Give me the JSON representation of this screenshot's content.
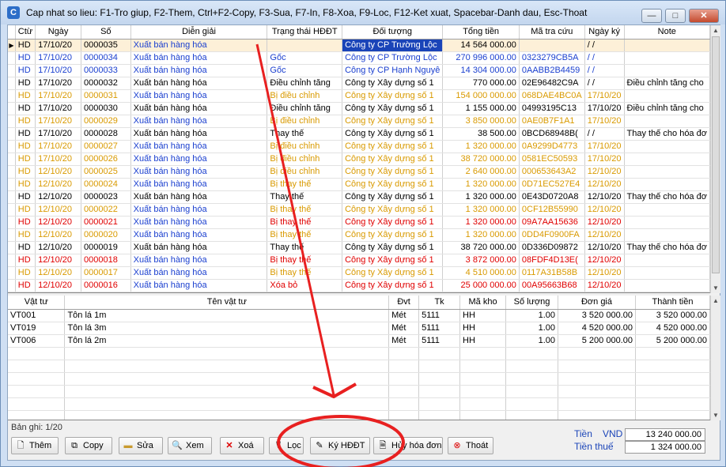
{
  "title": "Cap nhat so lieu: F1-Tro giup, F2-Them, Ctrl+F2-Copy, F3-Sua, F7-In, F8-Xoa, F9-Loc, F12-Ket xuat, Spacebar-Danh dau, Esc-Thoat",
  "window_buttons": {
    "minimize": "—",
    "maximize": "□",
    "close": "✕"
  },
  "columns": [
    "Ctừ",
    "Ngày",
    "Số",
    "Diễn giải",
    "Trạng thái HĐĐT",
    "Đối tượng",
    "Tổng tiền",
    "Mã tra cứu",
    "Ngày ký",
    "Note"
  ],
  "rows": [
    {
      "ct": "HD",
      "ngay": "17/10/20",
      "so": "0000035",
      "dg": "Xuất bán hàng hóa",
      "tt": "",
      "dt": "Công ty CP Trường Lộc",
      "tien": "14 564 000.00",
      "ma": "",
      "nk": "/ /",
      "note": "",
      "color": "sel"
    },
    {
      "ct": "HD",
      "ngay": "17/10/20",
      "so": "0000034",
      "dg": "Xuất bán hàng hóa",
      "tt": "Gốc",
      "dt": "Công ty CP Trường Lộc",
      "tien": "270 996 000.00",
      "ma": "0323279CB5A",
      "nk": "/ /",
      "note": "",
      "color": "blue"
    },
    {
      "ct": "HD",
      "ngay": "17/10/20",
      "so": "0000033",
      "dg": "Xuất bán hàng hóa",
      "tt": "Gốc",
      "dt": "Công ty CP Hạnh Nguyê",
      "tien": "14 304 000.00",
      "ma": "0AABB2B4459",
      "nk": "/ /",
      "note": "",
      "color": "blue"
    },
    {
      "ct": "HD",
      "ngay": "17/10/20",
      "so": "0000032",
      "dg": "Xuất bán hàng hóa",
      "tt": "Điều chỉnh tăng",
      "dt": "Công ty Xây dựng số 1",
      "tien": "770 000.00",
      "ma": "02E96482C9A",
      "nk": "/ /",
      "note": "Điều chỉnh tăng cho",
      "color": "black"
    },
    {
      "ct": "HD",
      "ngay": "17/10/20",
      "so": "0000031",
      "dg": "Xuất bán hàng hóa",
      "tt": "Bị điều chỉnh",
      "dt": "Công ty Xây dựng số 1",
      "tien": "154 000 000.00",
      "ma": "068DAE4BC0A",
      "nk": "17/10/20",
      "note": "",
      "color": "orange"
    },
    {
      "ct": "HD",
      "ngay": "17/10/20",
      "so": "0000030",
      "dg": "Xuất bán hàng hóa",
      "tt": "Điều chỉnh tăng",
      "dt": "Công ty Xây dựng số 1",
      "tien": "1 155 000.00",
      "ma": "04993195C13",
      "nk": "17/10/20",
      "note": "Điều chỉnh tăng cho",
      "color": "black"
    },
    {
      "ct": "HD",
      "ngay": "17/10/20",
      "so": "0000029",
      "dg": "Xuất bán hàng hóa",
      "tt": "Bị điều chỉnh",
      "dt": "Công ty Xây dựng số 1",
      "tien": "3 850 000.00",
      "ma": "0AE0B7F1A1",
      "nk": "17/10/20",
      "note": "",
      "color": "orange"
    },
    {
      "ct": "HD",
      "ngay": "17/10/20",
      "so": "0000028",
      "dg": "Xuất bán hàng hóa",
      "tt": "Thay thế",
      "dt": "Công ty Xây dựng số 1",
      "tien": "38 500.00",
      "ma": "0BCD68948B(",
      "nk": "/ /",
      "note": "Thay thế cho hóa đơ",
      "color": "black"
    },
    {
      "ct": "HD",
      "ngay": "17/10/20",
      "so": "0000027",
      "dg": "Xuất bán hàng hóa",
      "tt": "Bị điều chỉnh",
      "dt": "Công ty Xây dựng số 1",
      "tien": "1 320 000.00",
      "ma": "0A9299D4773",
      "nk": "17/10/20",
      "note": "",
      "color": "orange"
    },
    {
      "ct": "HD",
      "ngay": "17/10/20",
      "so": "0000026",
      "dg": "Xuất bán hàng hóa",
      "tt": "Bị điều chỉnh",
      "dt": "Công ty Xây dựng số 1",
      "tien": "38 720 000.00",
      "ma": "0581EC50593",
      "nk": "17/10/20",
      "note": "",
      "color": "orange"
    },
    {
      "ct": "HD",
      "ngay": "12/10/20",
      "so": "0000025",
      "dg": "Xuất bán hàng hóa",
      "tt": "Bị điều chỉnh",
      "dt": "Công ty Xây dựng số 1",
      "tien": "2 640 000.00",
      "ma": "000653643A2",
      "nk": "12/10/20",
      "note": "",
      "color": "orange"
    },
    {
      "ct": "HD",
      "ngay": "12/10/20",
      "so": "0000024",
      "dg": "Xuất bán hàng hóa",
      "tt": "Bị thay thế",
      "dt": "Công ty Xây dựng số 1",
      "tien": "1 320 000.00",
      "ma": "0D71EC527E4",
      "nk": "12/10/20",
      "note": "",
      "color": "orange"
    },
    {
      "ct": "HD",
      "ngay": "12/10/20",
      "so": "0000023",
      "dg": "Xuất bán hàng hóa",
      "tt": "Thay thế",
      "dt": "Công ty Xây dựng số 1",
      "tien": "1 320 000.00",
      "ma": "0E43D0720A8",
      "nk": "12/10/20",
      "note": "Thay thế cho hóa đơ",
      "color": "black"
    },
    {
      "ct": "HD",
      "ngay": "12/10/20",
      "so": "0000022",
      "dg": "Xuất bán hàng hóa",
      "tt": "Bị thay thế",
      "dt": "Công ty Xây dựng số 1",
      "tien": "1 320 000.00",
      "ma": "0CF12B55990",
      "nk": "12/10/20",
      "note": "",
      "color": "orange"
    },
    {
      "ct": "HD",
      "ngay": "12/10/20",
      "so": "0000021",
      "dg": "Xuất bán hàng hóa",
      "tt": "Bị thay thế",
      "dt": "Công ty Xây dựng số 1",
      "tien": "1 320 000.00",
      "ma": "09A7AA15636",
      "nk": "12/10/20",
      "note": "",
      "color": "red"
    },
    {
      "ct": "HD",
      "ngay": "12/10/20",
      "so": "0000020",
      "dg": "Xuất bán hàng hóa",
      "tt": "Bị thay thế",
      "dt": "Công ty Xây dựng số 1",
      "tien": "1 320 000.00",
      "ma": "0DD4F0900FA",
      "nk": "12/10/20",
      "note": "",
      "color": "orange"
    },
    {
      "ct": "HD",
      "ngay": "12/10/20",
      "so": "0000019",
      "dg": "Xuất bán hàng hóa",
      "tt": "Thay thế",
      "dt": "Công ty Xây dựng số 1",
      "tien": "38 720 000.00",
      "ma": "0D336D09872",
      "nk": "12/10/20",
      "note": "Thay thế cho hóa đơ",
      "color": "black"
    },
    {
      "ct": "HD",
      "ngay": "12/10/20",
      "so": "0000018",
      "dg": "Xuất bán hàng hóa",
      "tt": "Bị thay thế",
      "dt": "Công ty Xây dựng số 1",
      "tien": "3 872 000.00",
      "ma": "08FDF4D13E(",
      "nk": "12/10/20",
      "note": "",
      "color": "red"
    },
    {
      "ct": "HD",
      "ngay": "12/10/20",
      "so": "0000017",
      "dg": "Xuất bán hàng hóa",
      "tt": "Bị thay thế",
      "dt": "Công ty Xây dựng số 1",
      "tien": "4 510 000.00",
      "ma": "0117A31B58B",
      "nk": "12/10/20",
      "note": "",
      "color": "orange"
    },
    {
      "ct": "HD",
      "ngay": "12/10/20",
      "so": "0000016",
      "dg": "Xuất bán hàng hóa",
      "tt": "Xóa bỏ",
      "dt": "Công ty Xây dựng số 1",
      "tien": "25 000 000.00",
      "ma": "00A95663B68",
      "nk": "12/10/20",
      "note": "",
      "color": "red"
    }
  ],
  "detail_columns": [
    "Vật tư",
    "Tên vật tư",
    "Đvt",
    "Tk",
    "Mã kho",
    "Số lượng",
    "Đơn giá",
    "Thành tiền"
  ],
  "detail_rows": [
    {
      "vt": "VT001",
      "ten": "Tôn lá 1m",
      "dvt": "Mét",
      "tk": "5111",
      "kho": "HH",
      "sl": "1.00",
      "dg": "3 520 000.00",
      "tt": "3 520 000.00"
    },
    {
      "vt": "VT019",
      "ten": "Tôn lá 3m",
      "dvt": "Mét",
      "tk": "5111",
      "kho": "HH",
      "sl": "1.00",
      "dg": "4 520 000.00",
      "tt": "4 520 000.00"
    },
    {
      "vt": "VT006",
      "ten": "Tôn lá 2m",
      "dvt": "Mét",
      "tk": "5111",
      "kho": "HH",
      "sl": "1.00",
      "dg": "5 200 000.00",
      "tt": "5 200 000.00"
    }
  ],
  "status": "Bản ghi: 1/20",
  "buttons": {
    "them": "Thêm",
    "copy": "Copy",
    "sua": "Sửa",
    "xem": "Xem",
    "xoa": "Xoá",
    "loc": "Lọc",
    "ky": "Ký HĐĐT",
    "huy": "Hủy hóa đơn",
    "thoat": "Thoát"
  },
  "totals": {
    "tien_label": "Tiền",
    "currency": "VND",
    "tien": "13 240 000.00",
    "thue_label": "Tiền thuế",
    "thue": "1 324 000.00"
  },
  "colors": {
    "blue": "#1a3fcf",
    "orange": "#d99a00",
    "red": "#e00000",
    "annotation": "#e82020"
  }
}
